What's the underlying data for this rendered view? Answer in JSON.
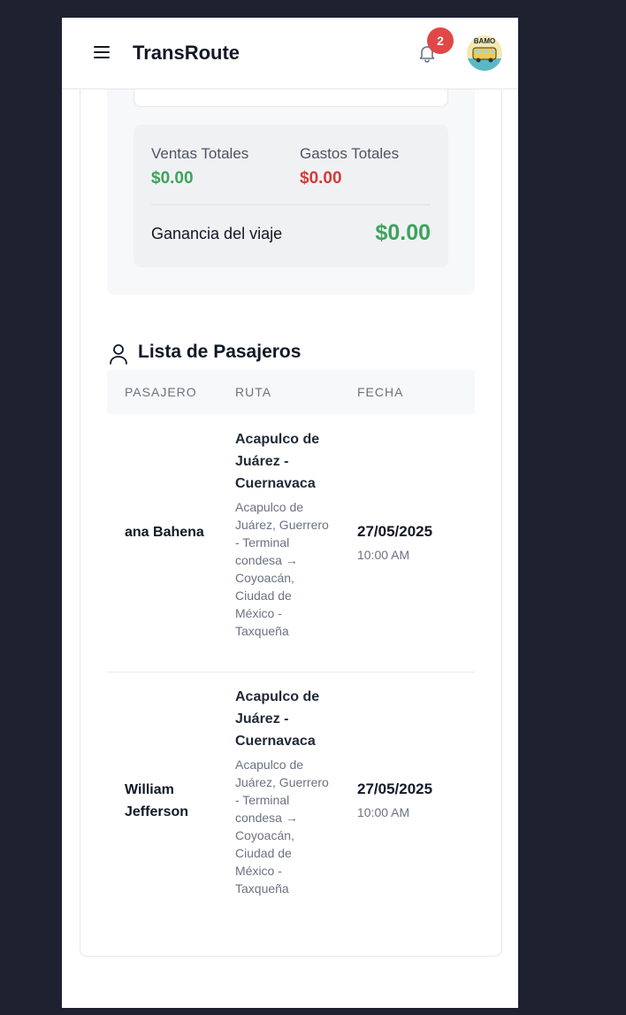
{
  "app": {
    "brand": "TransRoute",
    "notifications_count": "2",
    "avatar_text": "BAMO"
  },
  "summary": {
    "sales_label": "Ventas Totales",
    "sales_value": "$0.00",
    "expenses_label": "Gastos Totales",
    "expenses_value": "$0.00",
    "profit_label": "Ganancia del viaje",
    "profit_value": "$0.00",
    "colors": {
      "positive": "#3da35d",
      "negative": "#d23b3b"
    }
  },
  "passengers": {
    "title": "Lista de Pasajeros",
    "columns": [
      "PASAJERO",
      "RUTA",
      "FECHA"
    ],
    "rows": [
      {
        "name": "ana Bahena",
        "route_title": "Acapulco de Juárez - Cuernavaca",
        "route_detail": "Acapulco de Juárez, Guerrero - Terminal condesa → Coyoacán, Ciudad de México - Taxqueña",
        "date": "27/05/2025",
        "time": "10:00 AM"
      },
      {
        "name": "William Jefferson",
        "route_title": "Acapulco de Juárez - Cuernavaca",
        "route_detail": "Acapulco de Juárez, Guerrero - Terminal condesa → Coyoacán, Ciudad de México - Taxqueña",
        "date": "27/05/2025",
        "time": "10:00 AM"
      }
    ]
  }
}
